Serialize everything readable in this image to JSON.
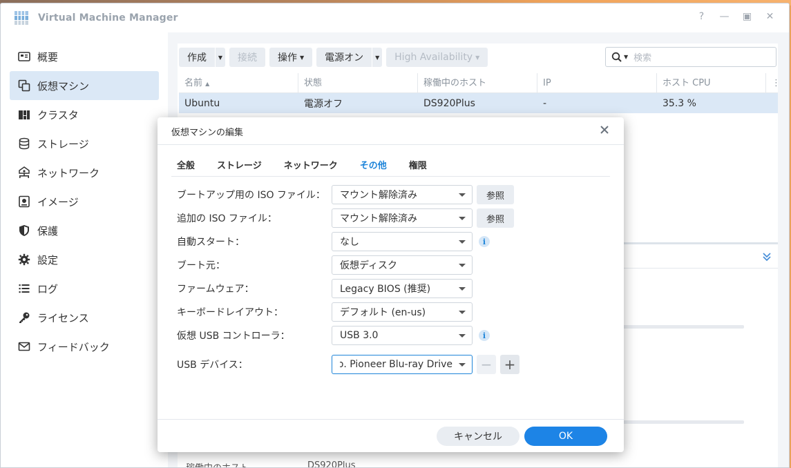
{
  "window": {
    "title": "Virtual Machine Manager"
  },
  "sidebar": {
    "items": [
      {
        "label": "概要",
        "icon": "overview-icon"
      },
      {
        "label": "仮想マシン",
        "icon": "vm-icon",
        "active": true
      },
      {
        "label": "クラスタ",
        "icon": "cluster-icon"
      },
      {
        "label": "ストレージ",
        "icon": "storage-icon"
      },
      {
        "label": "ネットワーク",
        "icon": "network-icon"
      },
      {
        "label": "イメージ",
        "icon": "image-icon"
      },
      {
        "label": "保護",
        "icon": "shield-icon"
      },
      {
        "label": "設定",
        "icon": "gear-icon"
      },
      {
        "label": "ログ",
        "icon": "log-icon"
      },
      {
        "label": "ライセンス",
        "icon": "key-icon"
      },
      {
        "label": "フィードバック",
        "icon": "mail-icon"
      }
    ]
  },
  "toolbar": {
    "create": "作成",
    "connect": "接続",
    "action": "操作",
    "power_on": "電源オン",
    "high_availability": "High Availability",
    "search_placeholder": "検索"
  },
  "table": {
    "headers": [
      "名前",
      "状態",
      "稼働中のホスト",
      "IP",
      "ホスト CPU"
    ],
    "rows": [
      [
        "Ubuntu",
        "電源オフ",
        "DS920Plus",
        "-",
        "35.3 %"
      ]
    ]
  },
  "background": {
    "partial_text": "稼働中のホスト",
    "partial_value": "DS920Plus"
  },
  "modal": {
    "title": "仮想マシンの編集",
    "tabs": [
      "全般",
      "ストレージ",
      "ネットワーク",
      "その他",
      "権限"
    ],
    "active_tab": "その他",
    "fields": {
      "boot_iso": {
        "label": "ブートアップ用の ISO ファイル：",
        "value": "マウント解除済み",
        "button": "参照"
      },
      "extra_iso": {
        "label": "追加の ISO ファイル：",
        "value": "マウント解除済み",
        "button": "参照"
      },
      "autostart": {
        "label": "自動スタート：",
        "value": "なし"
      },
      "boot_from": {
        "label": "ブート元：",
        "value": "仮想ディスク"
      },
      "firmware": {
        "label": "ファームウェア：",
        "value": "Legacy BIOS (推奨)"
      },
      "keyboard": {
        "label": "キーボードレイアウト：",
        "value": "デフォルト (en-us)"
      },
      "usb_controller": {
        "label": "仮想 USB コントローラ：",
        "value": "USB 3.0"
      },
      "usb_device": {
        "label": "USB デバイス：",
        "value": "orp. Pioneer Blu-ray Drive"
      }
    },
    "cancel": "キャンセル",
    "ok": "OK"
  },
  "colors": {
    "accent": "#1d84e6",
    "selected_row": "#dbe8f6"
  }
}
